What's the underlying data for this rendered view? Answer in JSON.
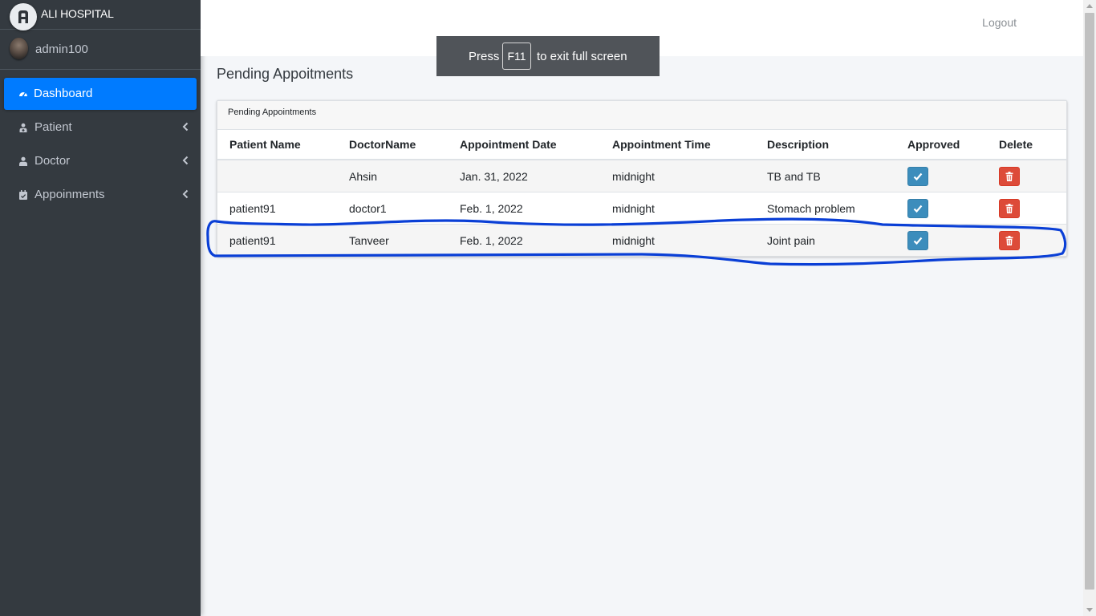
{
  "sidebar": {
    "brand": "ALI HOSPITAL",
    "user": "admin100",
    "items": [
      {
        "label": "Dashboard",
        "icon": "dashboard-gauge-icon"
      },
      {
        "label": "Patient",
        "icon": "patient-icon"
      },
      {
        "label": "Doctor",
        "icon": "doctor-icon"
      },
      {
        "label": "Appoinments",
        "icon": "calendar-check-icon"
      }
    ]
  },
  "header": {
    "logout": "Logout"
  },
  "fullscreen_notice": {
    "press": "Press",
    "key": "F11",
    "rest": "to exit full screen"
  },
  "main": {
    "title": "Pending Appoitments",
    "card_title": "Pending Appointments",
    "columns": [
      "Patient Name",
      "DoctorName",
      "Appointment Date",
      "Appointment Time",
      "Description",
      "Approved",
      "Delete"
    ],
    "rows": [
      {
        "patient": "",
        "doctor": "Ahsin",
        "date": "Jan. 31, 2022",
        "time": "midnight",
        "description": "TB and TB"
      },
      {
        "patient": "patient91",
        "doctor": "doctor1",
        "date": "Feb. 1, 2022",
        "time": "midnight",
        "description": "Stomach problem"
      },
      {
        "patient": "patient91",
        "doctor": "Tanveer",
        "date": "Feb. 1, 2022",
        "time": "midnight",
        "description": "Joint pain"
      }
    ]
  },
  "colors": {
    "sidebar_bg": "#343a40",
    "active_item": "#007bff",
    "approve_button": "#3c8dbc",
    "delete_button": "#dd4b39",
    "highlight_stroke": "#0a3fd6"
  }
}
